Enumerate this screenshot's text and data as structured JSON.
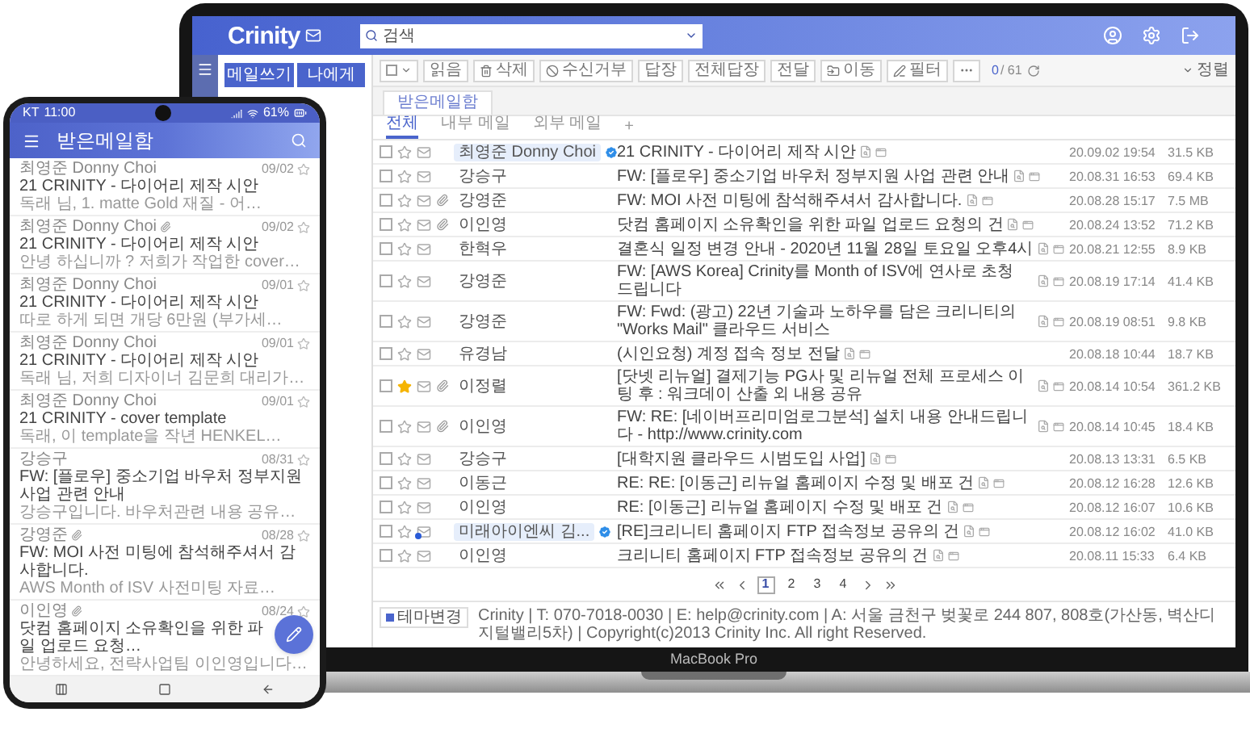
{
  "laptop": {
    "brand": "MacBook Pro",
    "app": {
      "logo": "Crinity",
      "search": {
        "placeholder": "검색"
      },
      "sidebar": {
        "buttons": [
          "메일쓰기",
          "나에게"
        ]
      },
      "toolbar": {
        "buttons": [
          {
            "kind": "select"
          },
          {
            "kind": "text",
            "label": "읽음"
          },
          {
            "kind": "trash",
            "label": "삭제"
          },
          {
            "kind": "block",
            "label": "수신거부"
          },
          {
            "kind": "text",
            "label": "답장"
          },
          {
            "kind": "text",
            "label": "전체답장"
          },
          {
            "kind": "text",
            "label": "전달"
          },
          {
            "kind": "move",
            "label": "이동"
          },
          {
            "kind": "filter",
            "label": "필터"
          },
          {
            "kind": "more"
          }
        ],
        "counter": {
          "selected": "0",
          "total": "/ 61"
        },
        "sort": "정렬"
      },
      "folder_tab": "받은메일함",
      "filter_tabs": [
        {
          "label": "전체",
          "selected": true
        },
        {
          "label": "내부 메일",
          "selected": false
        },
        {
          "label": "외부 메일",
          "selected": false
        }
      ],
      "add_tab": "+",
      "mails": [
        {
          "sender": "최영준 Donny Choi",
          "sender_chip": true,
          "verified": true,
          "checked": false,
          "starred": false,
          "attachment": false,
          "unread": false,
          "subject": "21 CRINITY - 다이어리 제작 시안",
          "date": "20.09.02 19:54",
          "size": "31.5 KB"
        },
        {
          "sender": "강승구",
          "sender_chip": false,
          "verified": false,
          "checked": false,
          "starred": false,
          "attachment": false,
          "unread": false,
          "subject": "FW: [플로우] 중소기업 바우처 정부지원 사업 관련 안내",
          "date": "20.08.31 16:53",
          "size": "69.4 KB"
        },
        {
          "sender": "강영준",
          "sender_chip": false,
          "verified": false,
          "checked": false,
          "starred": false,
          "attachment": true,
          "unread": false,
          "subject": "FW: MOI 사전 미팅에 참석해주셔서 감사합니다.",
          "date": "20.08.28 15:17",
          "size": "7.5 MB"
        },
        {
          "sender": "이인영",
          "sender_chip": false,
          "verified": false,
          "checked": false,
          "starred": false,
          "attachment": true,
          "unread": false,
          "subject": "닷컴 홈페이지 소유확인을 위한 파일 업로드 요청의 건",
          "date": "20.08.24 13:52",
          "size": "71.2 KB"
        },
        {
          "sender": "한혁우",
          "sender_chip": false,
          "verified": false,
          "checked": false,
          "starred": false,
          "attachment": false,
          "unread": false,
          "subject": "결혼식 일정 변경 안내 - 2020년 11월 28일 토요일 오후4시",
          "date": "20.08.21 12:55",
          "size": "8.9 KB"
        },
        {
          "sender": "강영준",
          "sender_chip": false,
          "verified": false,
          "checked": false,
          "starred": false,
          "attachment": false,
          "unread": false,
          "subject": "FW: [AWS Korea] Crinity를 Month of ISV에 연사로 초청 드립니다",
          "date": "20.08.19 17:14",
          "size": "41.4 KB"
        },
        {
          "sender": "강영준",
          "sender_chip": false,
          "verified": false,
          "checked": false,
          "starred": false,
          "attachment": false,
          "unread": false,
          "subject": "FW: Fwd: (광고) 22년 기술과 노하우를 담은 크리니티의 \"Works Mail\" 클라우드 서비스",
          "date": "20.08.19 08:51",
          "size": "9.8 KB"
        },
        {
          "sender": "유경남",
          "sender_chip": false,
          "verified": false,
          "checked": false,
          "starred": false,
          "attachment": false,
          "unread": false,
          "subject": "(시인요청) 계정 접속 정보 전달",
          "date": "20.08.18 10:44",
          "size": "18.7 KB"
        },
        {
          "sender": "이정렬",
          "sender_chip": false,
          "verified": false,
          "checked": false,
          "starred": true,
          "attachment": true,
          "unread": false,
          "subject": "[닷넷 리뉴얼] 결제기능 PG사 및 리뉴얼 전체 프로세스 이팅 후 : 워크데이 산출 외 내용 공유",
          "date": "20.08.14 10:54",
          "size": "361.2 KB"
        },
        {
          "sender": "이인영",
          "sender_chip": false,
          "verified": false,
          "checked": false,
          "starred": false,
          "attachment": true,
          "unread": false,
          "subject": "FW: RE: [네이버프리미엄로그분석] 설치 내용 안내드립니다 - http://www.crinity.com",
          "date": "20.08.14 10:45",
          "size": "18.4 KB"
        },
        {
          "sender": "강승구",
          "sender_chip": false,
          "verified": false,
          "checked": false,
          "starred": false,
          "attachment": false,
          "unread": false,
          "subject": "[대학지원 클라우드 시범도입 사업]",
          "date": "20.08.13 13:31",
          "size": "6.5 KB"
        },
        {
          "sender": "이동근",
          "sender_chip": false,
          "verified": false,
          "checked": false,
          "starred": false,
          "attachment": false,
          "unread": false,
          "subject": "RE: RE: [이동근] 리뉴얼 홈페이지 수정 및 배포 건",
          "date": "20.08.12 16:28",
          "size": "12.6 KB"
        },
        {
          "sender": "이인영",
          "sender_chip": false,
          "verified": false,
          "checked": false,
          "starred": false,
          "attachment": false,
          "unread": false,
          "subject": "RE: [이동근] 리뉴얼 홈페이지 수정 및 배포 건",
          "date": "20.08.12 16:07",
          "size": "10.6 KB"
        },
        {
          "sender": "미래아이엔씨 김...",
          "sender_chip": true,
          "verified": true,
          "checked": false,
          "starred": false,
          "attachment": false,
          "unread": true,
          "subject": "[RE]크리니티 홈페이지 FTP 접속정보 공유의 건",
          "date": "20.08.12 16:02",
          "size": "41.0 KB"
        },
        {
          "sender": "이인영",
          "sender_chip": false,
          "verified": false,
          "checked": false,
          "starred": false,
          "attachment": false,
          "unread": false,
          "subject": "크리니티 홈페이지 FTP 접속정보 공유의 건",
          "date": "20.08.11 15:33",
          "size": "6.4 KB"
        }
      ],
      "pages": [
        {
          "label": "1",
          "selected": true
        },
        {
          "label": "2",
          "selected": false
        },
        {
          "label": "3",
          "selected": false
        },
        {
          "label": "4",
          "selected": false
        }
      ],
      "footer": {
        "theme_button": "테마변경",
        "text": "Crinity | T: 070-7018-0030 | E: help@crinity.com | A: 서울 금천구 벚꽃로 244 807, 808호(가산동, 벽산디지털밸리5차) | Copyright(c)2013 Crinity Inc. All right Reserved."
      }
    }
  },
  "phone": {
    "carrier": "KT",
    "time": "11:00",
    "battery": "61%",
    "title": "받은메일함",
    "mails": [
      {
        "sender": "최영준 Donny Choi",
        "attachment": false,
        "starred": false,
        "date": "09/02",
        "subject": "21 CRINITY - 다이어리 제작 시안",
        "preview": "독래 님, 1. matte Gold 재질 - 어…"
      },
      {
        "sender": "최영준 Donny Choi",
        "attachment": true,
        "starred": false,
        "date": "09/02",
        "subject": "21 CRINITY - 다이어리 제작 시안",
        "preview": "안녕 하십니까 ? 저희가 작업한 cover…"
      },
      {
        "sender": "최영준 Donny Choi",
        "attachment": false,
        "starred": false,
        "date": "09/01",
        "subject": "21 CRINITY - 다이어리 제작 시안",
        "preview": "따로 하게 되면 개당 6만원 (부가세…"
      },
      {
        "sender": "최영준 Donny Choi",
        "attachment": false,
        "starred": false,
        "date": "09/01",
        "subject": "21 CRINITY - 다이어리 제작 시안",
        "preview": "독래 님, 저희 디자이너 김문희 대리가…"
      },
      {
        "sender": "최영준 Donny Choi",
        "attachment": false,
        "starred": false,
        "date": "09/01",
        "subject": "21 CRINITY - cover template",
        "preview": "독래, 이 template을 작년 HENKEL…"
      },
      {
        "sender": "강승구",
        "attachment": false,
        "starred": false,
        "date": "08/31",
        "subject": "FW: [플로우] 중소기업 바우처 정부지원 사업 관련 안내",
        "preview": "강승구입니다. 바우처관련 내용 공유…"
      },
      {
        "sender": "강영준",
        "attachment": true,
        "starred": false,
        "date": "08/28",
        "subject": "FW: MOI 사전 미팅에 참석해주셔서 감사합니다.",
        "preview": "AWS Month of ISV 사전미팅 자료…"
      },
      {
        "sender": "이인영",
        "attachment": true,
        "starred": false,
        "date": "08/24",
        "subject": "닷컴 홈페이지 소유확인을 위한 파일 업로드 요청…",
        "preview": "안녕하세요, 전략사업팀 이인영입니다…"
      }
    ]
  }
}
